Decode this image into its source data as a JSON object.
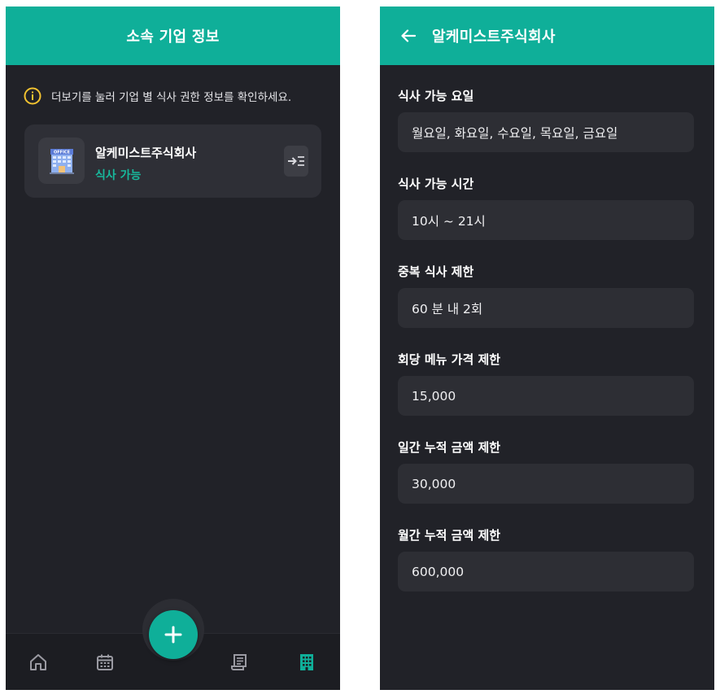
{
  "left": {
    "title": "소속 기업 정보",
    "notice": "더보기를 눌러 기업 별 식사 권한 정보를 확인하세요.",
    "company": {
      "name": "알케미스트주식회사",
      "status": "식사 가능",
      "logo_text": "OFFICE"
    },
    "nav": {
      "items": [
        "home-icon",
        "calendar-icon",
        "receipt-icon",
        "building-icon"
      ],
      "active": "building-icon",
      "fab_icon": "plus-icon"
    }
  },
  "right": {
    "title": "알케미스트주식회사",
    "fields": [
      {
        "label": "식사 가능 요일",
        "value": "월요일, 화요일, 수요일, 목요일, 금요일"
      },
      {
        "label": "식사 가능 시간",
        "value": "10시 ~ 21시"
      },
      {
        "label": "중복 식사 제한",
        "value": "60 분 내 2회"
      },
      {
        "label": "회당 메뉴 가격 제한",
        "value": "15,000"
      },
      {
        "label": "일간 누적 금액 제한",
        "value": "30,000"
      },
      {
        "label": "월간 누적 금액 제한",
        "value": "600,000"
      }
    ]
  },
  "colors": {
    "accent": "#0faf99",
    "background": "#212228",
    "card": "#2e2f36",
    "notice_icon": "#f2c230"
  }
}
